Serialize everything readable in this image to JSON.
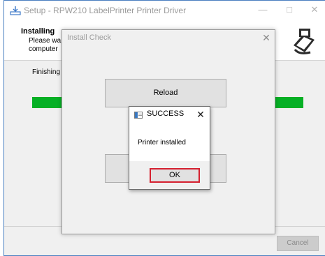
{
  "setup_window": {
    "title": "Setup - RPW210 LabelPrinter Printer Driver",
    "heading": "Installing",
    "subtext_line1": "Please wa",
    "subtext_line2": "computer",
    "status_text": "Finishing i",
    "progress_percent": 100,
    "cancel_label": "Cancel",
    "caption_buttons": {
      "minimize": "—",
      "maximize": "□",
      "close": "✕"
    }
  },
  "install_check": {
    "title": "Install Check",
    "close_glyph": "✕",
    "reload_label": "Reload"
  },
  "message_box": {
    "title": "SUCCESS",
    "close_glyph": "✕",
    "message": "Printer installed",
    "ok_label": "OK"
  },
  "colors": {
    "progress": "#06b025",
    "ok_focus_border": "#d5202f",
    "window_border": "#4a7fc0"
  },
  "icons": [
    "setup-icon",
    "printer-logo-icon",
    "message-box-icon"
  ]
}
